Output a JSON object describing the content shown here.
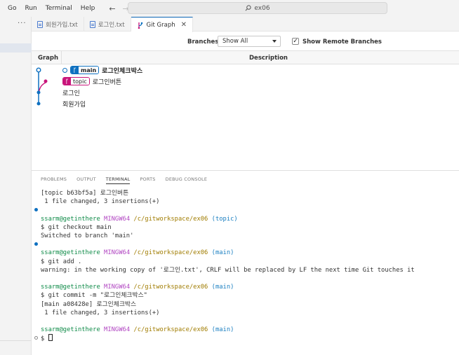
{
  "menu": [
    "Go",
    "Run",
    "Terminal",
    "Help"
  ],
  "nav": {
    "back": "←",
    "forward": "→"
  },
  "search": {
    "icon": "search-icon",
    "text": "ex06"
  },
  "sidebar": {
    "more": "···"
  },
  "tabs": [
    {
      "label": "회원가입.txt"
    },
    {
      "label": "로그인.txt"
    },
    {
      "label": "Git Graph",
      "close": "✕"
    }
  ],
  "gitgraph": {
    "branches_label": "Branches:",
    "branches_value": "Show All",
    "show_remote_label": "Show Remote Branches",
    "show_remote_checked": "✓",
    "columns": {
      "graph": "Graph",
      "description": "Description"
    },
    "commits": [
      {
        "ref": "main",
        "message": "로그인체크박스"
      },
      {
        "ref": "topic",
        "message": "로그인버튼"
      },
      {
        "message": "로그인"
      },
      {
        "message": "회원가입"
      }
    ],
    "colors": {
      "main": "#0e70c0",
      "topic": "#c8147a"
    }
  },
  "panel": {
    "tabs": [
      "PROBLEMS",
      "OUTPUT",
      "TERMINAL",
      "PORTS",
      "DEBUG CONSOLE"
    ],
    "terminal": {
      "l1": "[topic b63bf5a] 로그인버튼",
      "l2": " 1 file changed, 3 insertions(+)",
      "p_user": "ssarm@getinthere",
      "p_ming": "MINGW64",
      "p_path": "/c/gitworkspace/ex06",
      "p1_branch": "(topic)",
      "c1": "$ git checkout main",
      "o1": "Switched to branch 'main'",
      "p2_branch": "(main)",
      "c2": "$ git add .",
      "o2": "warning: in the working copy of '로그인.txt', CRLF will be replaced by LF the next time Git touches it",
      "p3_branch": "(main)",
      "c3": "$ git commit -m \"로그인체크박스\"",
      "o3a": "[main a08428e] 로그인체크박스",
      "o3b": " 1 file changed, 3 insertions(+)",
      "p4_branch": "(main)",
      "c4": "$ "
    }
  }
}
